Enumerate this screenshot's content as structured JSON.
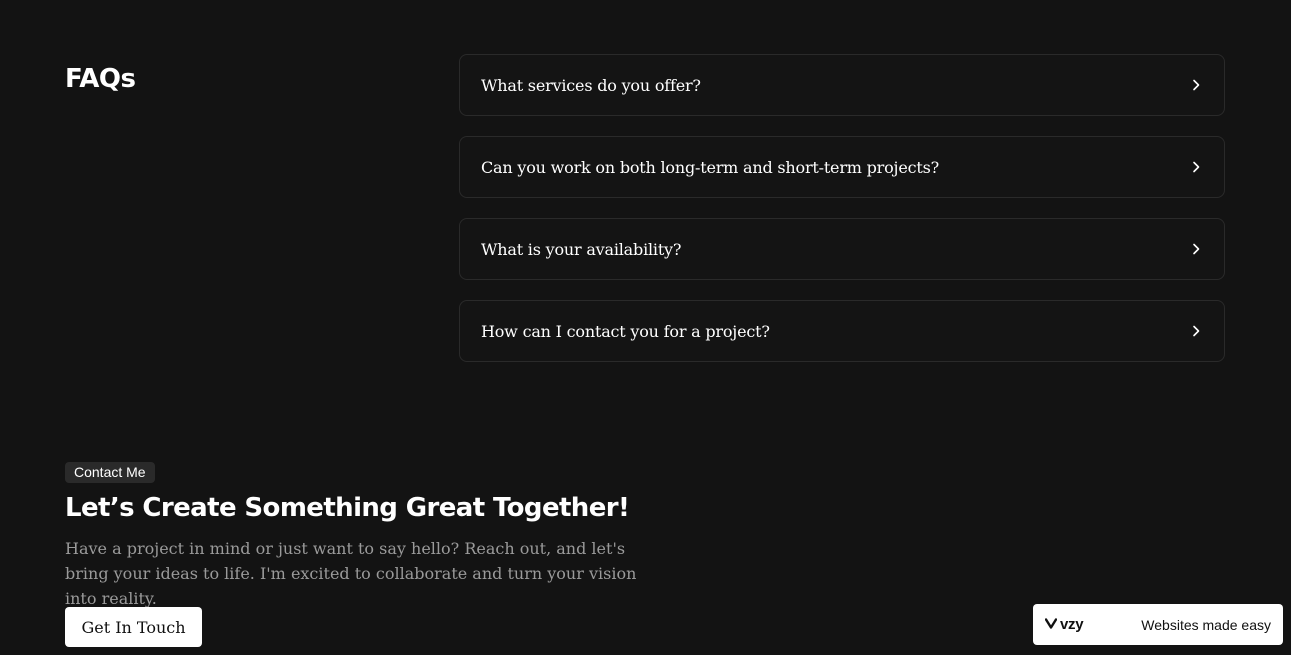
{
  "faq": {
    "title": "FAQs",
    "items": [
      {
        "question": "What services do you offer?",
        "icon": "chevron-right-icon"
      },
      {
        "question": "Can you work on both long-term and short-term projects?",
        "icon": "chevron-right-icon"
      },
      {
        "question": "What is your availability?",
        "icon": "chevron-right-icon"
      },
      {
        "question": "How can I contact you for a project?",
        "icon": "chevron-right-icon"
      }
    ]
  },
  "contact": {
    "badge": "Contact Me",
    "heading": "Let’s Create Something Great Together!",
    "text": "Have a project in mind or just want to say hello? Reach out, and let's bring your ideas to life. I'm excited to collaborate and turn your vision into reality.",
    "button_label": "Get In Touch"
  },
  "builder_badge": {
    "logo_text": "vzy",
    "logo_icon": "vzy-logo-icon",
    "tagline": "Websites made easy"
  },
  "colors": {
    "background": "#131313",
    "card_border": "#2a2a2a",
    "muted_text": "#9a9a9a",
    "button_bg": "#ffffff"
  }
}
